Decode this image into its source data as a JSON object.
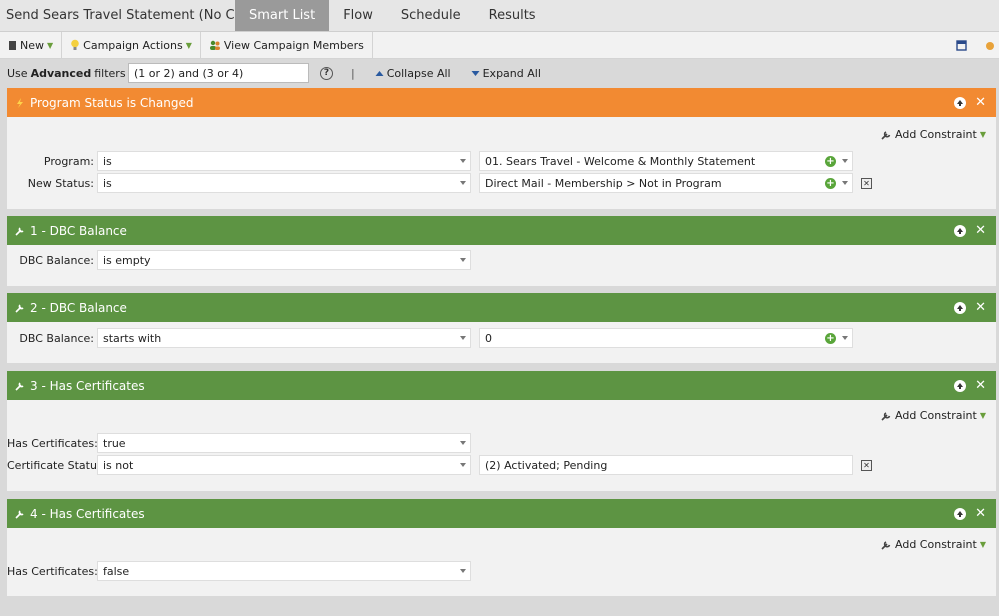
{
  "tabs": {
    "title": "Send Sears Travel Statement (No Cert/...",
    "smart_list": "Smart List",
    "flow": "Flow",
    "schedule": "Schedule",
    "results": "Results"
  },
  "toolbar": {
    "new_label": "New",
    "campaign_actions_label": "Campaign Actions",
    "view_members_label": "View Campaign Members"
  },
  "filterbar": {
    "use_label": "Use",
    "advanced_label": "Advanced",
    "filters_label": "filters",
    "logic_value": "(1 or 2) and (3 or 4)",
    "help_glyph": "?",
    "separator": "|",
    "collapse_all": "Collapse All",
    "expand_all": "Expand All"
  },
  "colors": {
    "trigger_header": "#f28a32",
    "filter_header": "#5d9443"
  },
  "cards": [
    {
      "title": "Program Status is Changed",
      "add_constraint": "Add Constraint",
      "rows": [
        {
          "label": "Program:",
          "operator": "is",
          "value": "01. Sears Travel - Welcome & Monthly Statement"
        },
        {
          "label": "New Status:",
          "operator": "is",
          "value": "Direct Mail - Membership > Not in Program"
        }
      ]
    },
    {
      "title": "1 - DBC Balance",
      "rows": [
        {
          "label": "DBC Balance:",
          "operator": "is empty"
        }
      ]
    },
    {
      "title": "2 - DBC Balance",
      "rows": [
        {
          "label": "DBC Balance:",
          "operator": "starts with",
          "value": "0"
        }
      ]
    },
    {
      "title": "3 - Has Certificates",
      "add_constraint": "Add Constraint",
      "rows": [
        {
          "label": "Has Certificates:",
          "operator": "true"
        },
        {
          "label": "Certificate Status:",
          "operator": "is not",
          "value": "(2) Activated; Pending"
        }
      ]
    },
    {
      "title": "4 - Has Certificates",
      "add_constraint": "Add Constraint",
      "rows": [
        {
          "label": "Has Certificates:",
          "operator": "false"
        }
      ]
    }
  ],
  "glyphs": {
    "plus": "+",
    "close": "✕",
    "remove": "✕"
  }
}
